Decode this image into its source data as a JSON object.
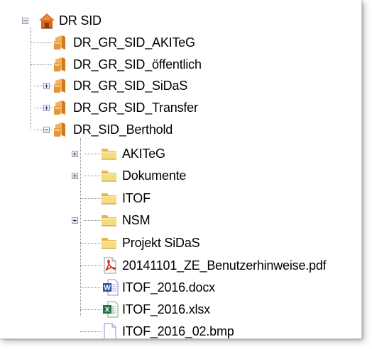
{
  "tree": {
    "nodes": [
      {
        "label": "DR SID",
        "icon": "home-folder-icon"
      },
      {
        "label": "DR_GR_SID_AKITeG",
        "icon": "shared-folder-icon"
      },
      {
        "label": "DR_GR_SID_öffentlich",
        "icon": "shared-folder-icon"
      },
      {
        "label": "DR_GR_SID_SiDaS",
        "icon": "shared-folder-icon"
      },
      {
        "label": "DR_GR_SID_Transfer",
        "icon": "shared-folder-icon"
      },
      {
        "label": "DR_SID_Berthold",
        "icon": "shared-folder-icon"
      },
      {
        "label": "AKITeG",
        "icon": "folder-icon"
      },
      {
        "label": "Dokumente",
        "icon": "folder-icon"
      },
      {
        "label": "ITOF",
        "icon": "folder-icon"
      },
      {
        "label": "NSM",
        "icon": "folder-icon"
      },
      {
        "label": "Projekt SiDaS",
        "icon": "folder-icon"
      },
      {
        "label": "20141101_ZE_Benutzerhinweise.pdf",
        "icon": "pdf-file-icon"
      },
      {
        "label": "ITOF_2016.docx",
        "icon": "word-file-icon"
      },
      {
        "label": "ITOF_2016.xlsx",
        "icon": "excel-file-icon"
      },
      {
        "label": "ITOF_2016_02.bmp",
        "icon": "bitmap-file-icon"
      }
    ]
  },
  "colors": {
    "tree_lines": "#8a8a8a",
    "folder": "#f2d675",
    "shared_folder": "#e6953a",
    "home_roof": "#d86a1e",
    "pdf": "#d9261c",
    "word": "#2b579a",
    "excel": "#217346"
  }
}
